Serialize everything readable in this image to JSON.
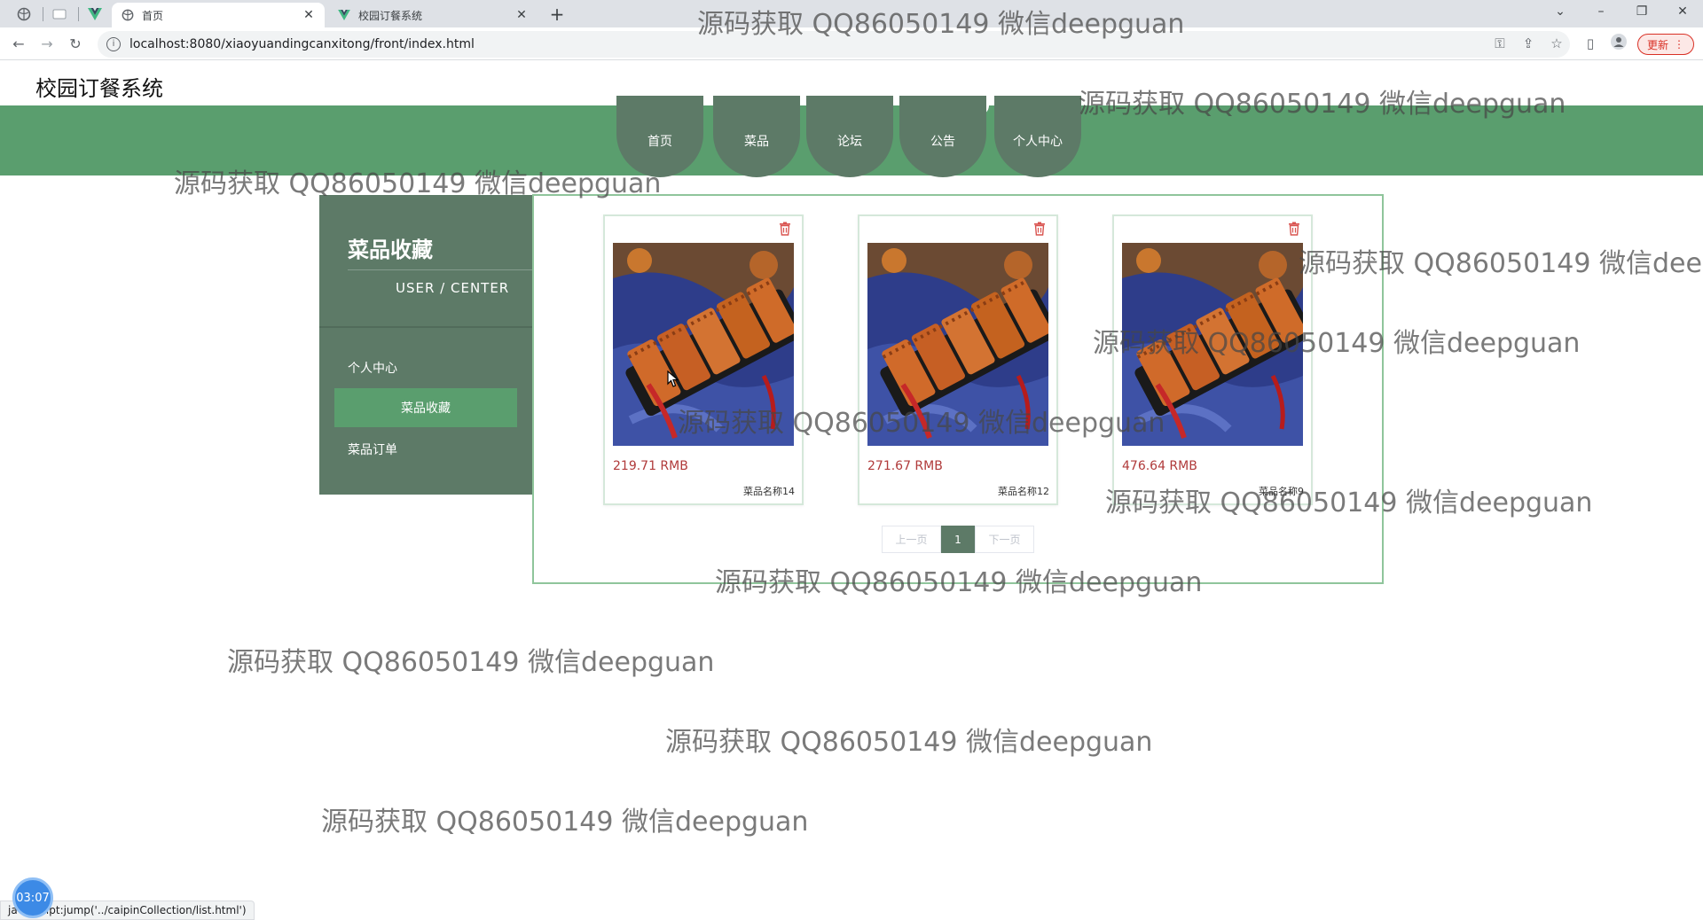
{
  "browser": {
    "tabs": [
      {
        "title": "首页"
      },
      {
        "title": "校园订餐系统"
      }
    ],
    "url": "localhost:8080/xiaoyuandingcanxitong/front/index.html",
    "update_label": "更新",
    "status_text": "javascript:jump('../caipinCollection/list.html')"
  },
  "site": {
    "title": "校园订餐系统",
    "nav": [
      "首页",
      "菜品",
      "论坛",
      "公告",
      "个人中心"
    ]
  },
  "sidebar": {
    "title": "菜品收藏",
    "subtitle": "USER / CENTER",
    "items": [
      "个人中心",
      "菜品收藏",
      "菜品订单"
    ],
    "active_index": 1
  },
  "cards": [
    {
      "price": "219.71 RMB",
      "name": "菜品名称14"
    },
    {
      "price": "271.67 RMB",
      "name": "菜品名称12"
    },
    {
      "price": "476.64 RMB",
      "name": "菜品名称9"
    }
  ],
  "pagination": {
    "prev": "上一页",
    "current": "1",
    "next": "下一页"
  },
  "watermark": "源码获取 QQ86050149 微信deepguan",
  "recording_time": "03:07",
  "colors": {
    "nav_green": "#5a9e6e",
    "dark_green": "#5d7a67",
    "price_red": "#b03a3a"
  }
}
